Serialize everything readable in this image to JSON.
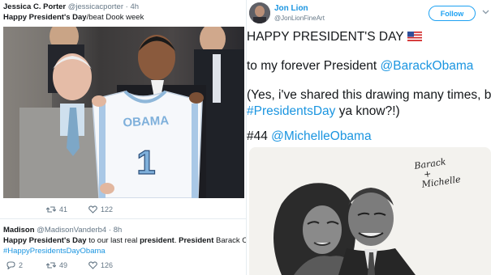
{
  "tweet1": {
    "name": "Jessica C. Porter",
    "handle": "@jessicacporter",
    "time": "4h",
    "text_bold": "Happy President's Day",
    "text_rest": "/beat Dook week",
    "jersey_word": "OBAMA",
    "jersey_number": "1",
    "retweets": "41",
    "likes": "122"
  },
  "tweet2": {
    "name": "Madison",
    "handle": "@MadisonVanderb4",
    "time": "8h",
    "t_bold1": "Happy President's Day",
    "t_mid1": " to our last real ",
    "t_bold2": "president",
    "t_mid2": ". ",
    "t_bold3": "President",
    "t_tail": " Barack Obama!",
    "hashtag": "#HappyPresidentsDayObama",
    "replies": "2",
    "retweets": "49",
    "likes": "126"
  },
  "tweet3": {
    "name": "Jon Lion",
    "handle": "@JonLionFineArt",
    "follow_label": "Follow",
    "line1": "HAPPY PRESIDENT'S DAY",
    "line2_pre": "to my forever President ",
    "line2_mention": "@BarackObama",
    "line3": "(Yes, i've shared this drawing many times, but,",
    "line4_tag": "#PresidentsDay",
    "line4_rest": " ya know?!)",
    "line5_pre": "#44 ",
    "line5_mention": "@MichelleObama",
    "signature_line1": "Barack",
    "signature_line2": "+",
    "signature_line3": "Michelle"
  },
  "icons": [
    "reply-icon",
    "retweet-icon",
    "heart-icon",
    "flag-icon",
    "chevron-down-icon"
  ],
  "colors": {
    "link": "#1b95e0",
    "muted": "#657786",
    "follow": "#1da1f2"
  }
}
